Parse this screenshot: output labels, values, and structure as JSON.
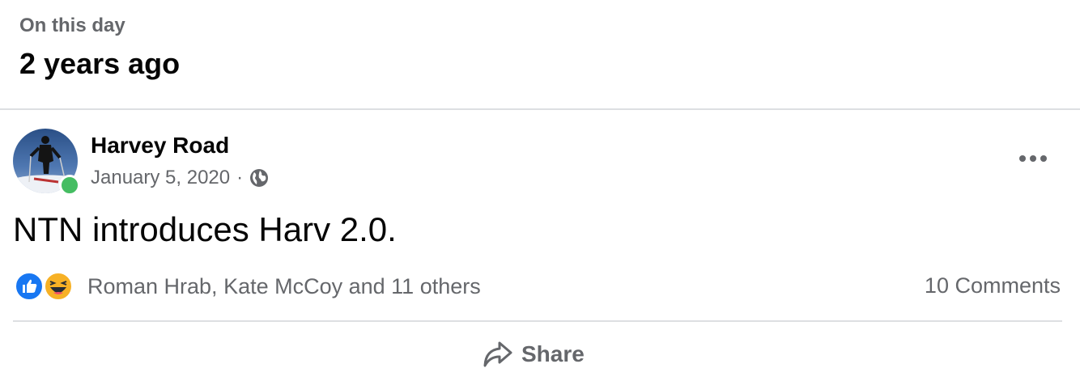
{
  "memory": {
    "label": "On this day",
    "title": "2 years ago"
  },
  "post": {
    "author": "Harvey Road",
    "date": "January 5, 2020",
    "separator": "·",
    "privacy_icon": "globe-icon",
    "text": "NTN introduces Harv 2.0.",
    "online": true
  },
  "reactions": {
    "icons": [
      "like-icon",
      "haha-icon"
    ],
    "names": "Roman Hrab, Kate McCoy and 11 others",
    "comments": "10 Comments"
  },
  "actions": {
    "share_label": "Share"
  },
  "colors": {
    "secondary_text": "#65676b",
    "like_blue": "#1877f2",
    "online_green": "#45bd62",
    "divider": "#dddfe2"
  }
}
